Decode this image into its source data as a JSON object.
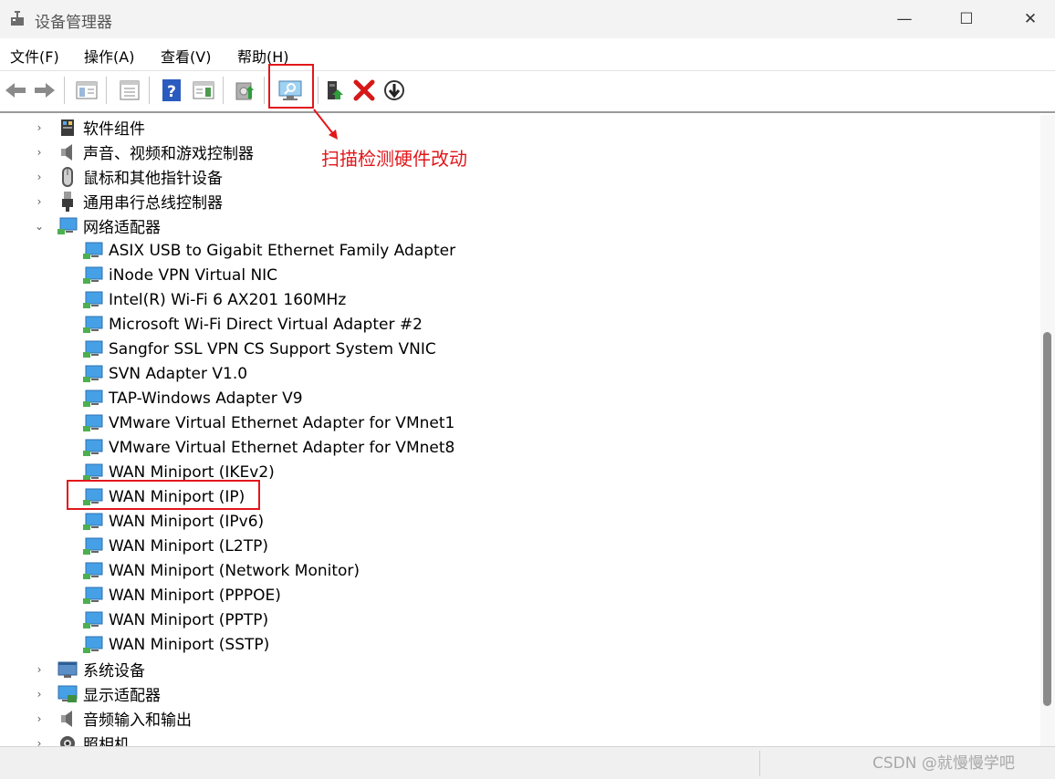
{
  "window": {
    "title": "设备管理器",
    "minimize_glyph": "—",
    "maximize_glyph": "☐",
    "close_glyph": "✕"
  },
  "menu": [
    {
      "label": "文件(F)"
    },
    {
      "label": "操作(A)"
    },
    {
      "label": "查看(V)"
    },
    {
      "label": "帮助(H)"
    }
  ],
  "toolbar": {
    "buttons": [
      "back-icon",
      "forward-icon",
      "show-hide-console-tree-icon",
      "properties-icon",
      "help-icon",
      "action-pane-icon",
      "update-driver-icon",
      "scan-hardware-changes-icon",
      "enable-device-icon",
      "uninstall-device-icon",
      "disable-device-icon"
    ],
    "accent_red": "#e2171b"
  },
  "annotation": {
    "label": "扫描检测硬件改动"
  },
  "tree": {
    "categories_before": [
      {
        "label": "软件组件",
        "icon": "software-component-icon",
        "expander": "›"
      },
      {
        "label": "声音、视频和游戏控制器",
        "icon": "speaker-icon",
        "expander": "›"
      },
      {
        "label": "鼠标和其他指针设备",
        "icon": "mouse-icon",
        "expander": "›"
      },
      {
        "label": "通用串行总线控制器",
        "icon": "usb-icon",
        "expander": "›"
      }
    ],
    "network": {
      "label": "网络适配器",
      "icon": "network-adapter-icon",
      "expander": "⌄",
      "children": [
        {
          "label": "ASIX USB to Gigabit Ethernet Family Adapter"
        },
        {
          "label": "iNode VPN Virtual NIC"
        },
        {
          "label": "Intel(R) Wi-Fi 6 AX201 160MHz"
        },
        {
          "label": "Microsoft Wi-Fi Direct Virtual Adapter #2"
        },
        {
          "label": "Sangfor SSL VPN CS Support System VNIC"
        },
        {
          "label": "SVN Adapter V1.0"
        },
        {
          "label": "TAP-Windows Adapter V9"
        },
        {
          "label": "VMware Virtual Ethernet Adapter for VMnet1"
        },
        {
          "label": "VMware Virtual Ethernet Adapter for VMnet8"
        },
        {
          "label": "WAN Miniport (IKEv2)"
        },
        {
          "label": "WAN Miniport (IP)"
        },
        {
          "label": "WAN Miniport (IPv6)"
        },
        {
          "label": "WAN Miniport (L2TP)"
        },
        {
          "label": "WAN Miniport (Network Monitor)"
        },
        {
          "label": "WAN Miniport (PPPOE)"
        },
        {
          "label": "WAN Miniport (PPTP)"
        },
        {
          "label": "WAN Miniport (SSTP)"
        }
      ]
    },
    "categories_after": [
      {
        "label": "系统设备",
        "icon": "system-devices-icon",
        "expander": "›"
      },
      {
        "label": "显示适配器",
        "icon": "display-adapter-icon",
        "expander": "›"
      },
      {
        "label": "音频输入和输出",
        "icon": "audio-io-icon",
        "expander": "›"
      },
      {
        "label": "照相机",
        "icon": "camera-icon",
        "expander": "›"
      }
    ]
  },
  "watermark": "CSDN @就慢慢学吧"
}
